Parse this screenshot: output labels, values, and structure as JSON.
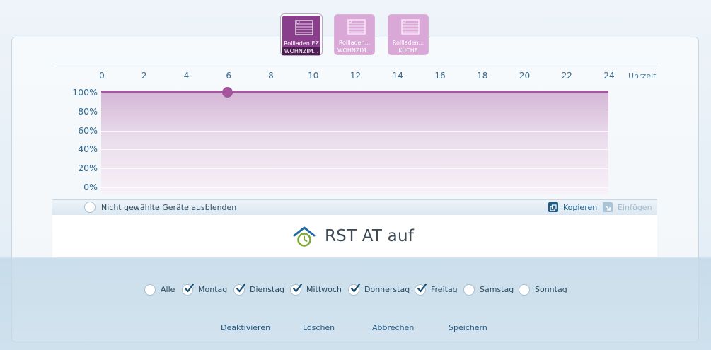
{
  "devices": [
    {
      "line1": "Rollladen EZ",
      "line2": "WOHNZIM...",
      "active": true
    },
    {
      "line1": "Rollladen...",
      "line2": "WOHNZIM...",
      "active": false
    },
    {
      "line1": "Rollladen...",
      "line2": "KÜCHE",
      "active": false
    }
  ],
  "chart_data": {
    "type": "line",
    "x_ticks": [
      "0",
      "2",
      "4",
      "6",
      "8",
      "10",
      "12",
      "14",
      "16",
      "18",
      "20",
      "22",
      "24"
    ],
    "x_label": "Uhrzeit",
    "y_ticks": [
      "100%",
      "80%",
      "60%",
      "40%",
      "20%",
      "0%"
    ],
    "xlim": [
      0,
      24
    ],
    "ylim": [
      0,
      100
    ],
    "series": [
      {
        "x": [
          0,
          24
        ],
        "y": [
          100,
          100
        ]
      }
    ],
    "control_point": {
      "x": 6,
      "y": 100
    },
    "colors": {
      "line": "#a5579f",
      "fill": "#d4b6d6"
    }
  },
  "toolbar": {
    "hide_unselected_label": "Nicht gewählte Geräte ausblenden",
    "copy_label": "Kopieren",
    "paste_label": "Einfügen"
  },
  "timer": {
    "title": "RST AT auf",
    "icon": "home-clock-icon"
  },
  "days": {
    "all": {
      "label": "Alle",
      "checked": false
    },
    "mon": {
      "label": "Montag",
      "checked": true
    },
    "tue": {
      "label": "Dienstag",
      "checked": true
    },
    "wed": {
      "label": "Mittwoch",
      "checked": true
    },
    "thu": {
      "label": "Donnerstag",
      "checked": true
    },
    "fri": {
      "label": "Freitag",
      "checked": true
    },
    "sat": {
      "label": "Samstag",
      "checked": false
    },
    "sun": {
      "label": "Sonntag",
      "checked": false
    }
  },
  "actions": {
    "deactivate": "Deaktivieren",
    "delete": "Löschen",
    "cancel": "Abbrechen",
    "save": "Speichern"
  }
}
